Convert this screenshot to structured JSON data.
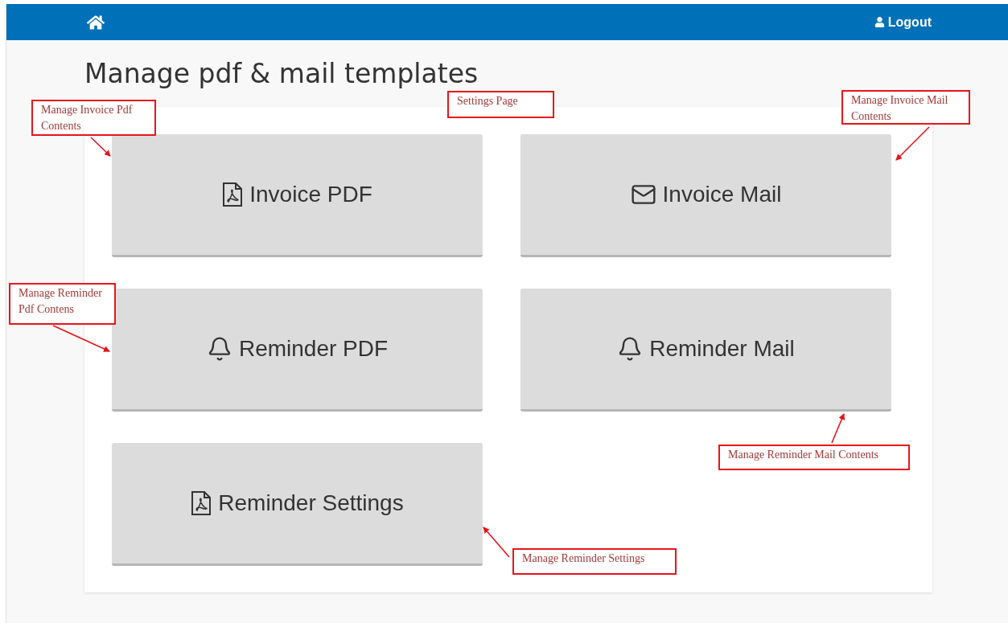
{
  "header": {
    "logout": "Logout"
  },
  "title": "Manage pdf & mail templates",
  "tiles": [
    {
      "kind": "pdf",
      "label": "Invoice PDF"
    },
    {
      "kind": "mail",
      "label": "Invoice Mail"
    },
    {
      "kind": "bell",
      "label": "Reminder PDF"
    },
    {
      "kind": "bell",
      "label": "Reminder Mail"
    },
    {
      "kind": "pdf",
      "label": "Reminder Settings"
    }
  ],
  "callouts": [
    {
      "text": "Manage Invoice Pdf Contents"
    },
    {
      "text": "Settings Page"
    },
    {
      "text": "Manage Invoice Mail Contents"
    },
    {
      "text": "Manage Reminder Pdf Contens"
    },
    {
      "text": "Manage Reminder Mail Contents"
    },
    {
      "text": "Manage Reminder Settings"
    }
  ]
}
